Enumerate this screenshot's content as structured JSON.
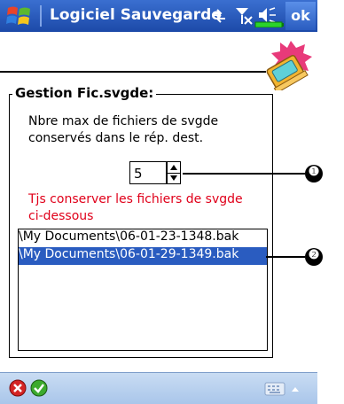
{
  "window": {
    "title": "Logiciel Sauvegarde",
    "ok_label": "ok",
    "status_icons": [
      "connectivity-icon",
      "signal-off-icon",
      "volume-icon",
      "battery-icon"
    ]
  },
  "group": {
    "title": "Gestion Fic.svgde:",
    "description": "Nbre max de fichiers de svgde conservés dans le rép. dest.",
    "max_files_value": "5",
    "keep_text": "Tjs conserver les fichiers de svgde ci-dessous",
    "files": [
      {
        "path": "\\My Documents\\06-01-23-1348.bak",
        "selected": false
      },
      {
        "path": "\\My Documents\\06-01-29-1349.bak",
        "selected": true
      }
    ]
  },
  "callouts": [
    "❶",
    "❷"
  ],
  "bottombar": {
    "icons": [
      "cancel-icon",
      "accept-icon",
      "keyboard-icon"
    ]
  },
  "colors": {
    "titlebar": "#1c49a8",
    "selection": "#2a5cc0",
    "warning_text": "#e0001a"
  }
}
